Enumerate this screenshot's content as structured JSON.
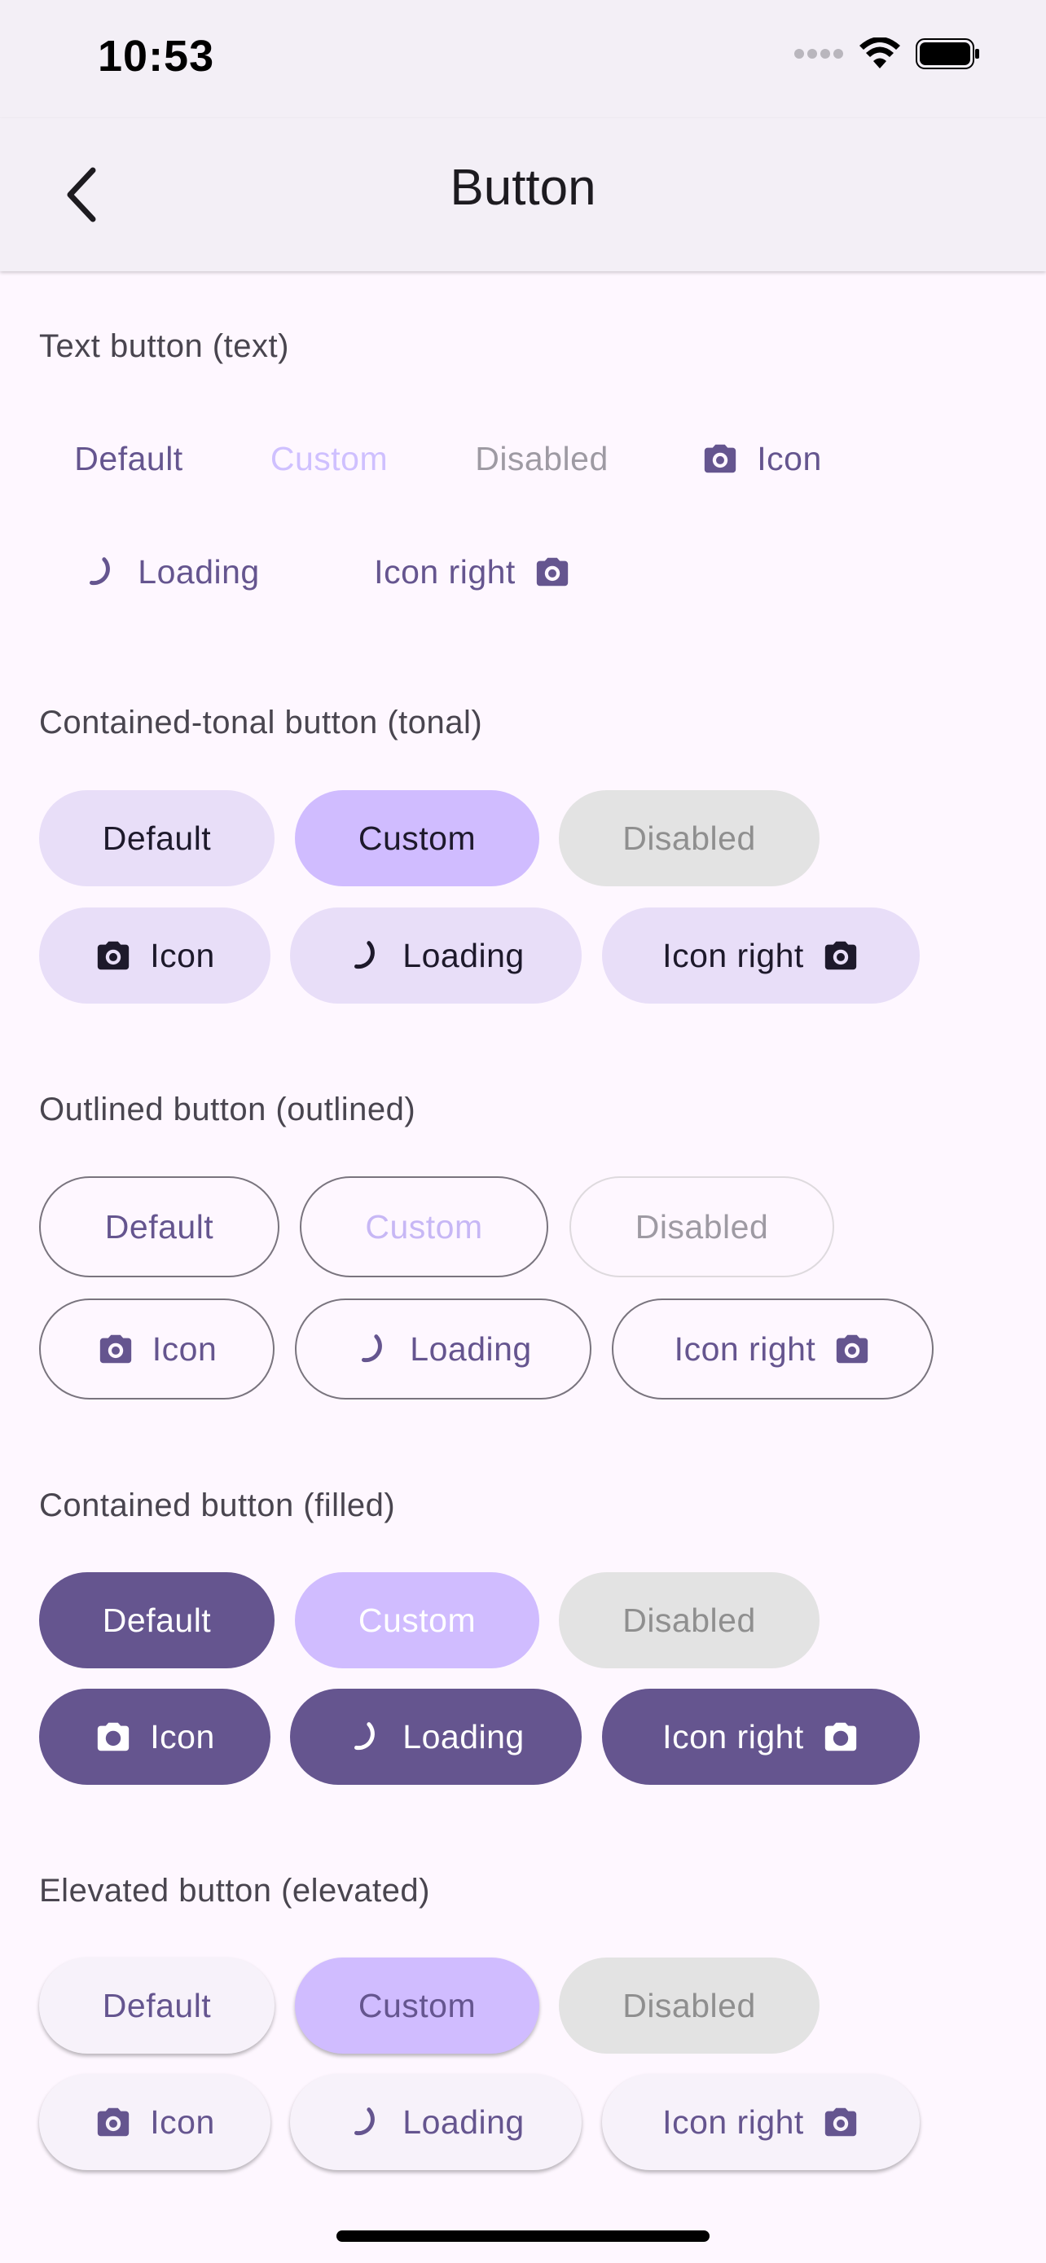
{
  "status_bar": {
    "time": "10:53"
  },
  "app_bar": {
    "title": "Button"
  },
  "colors": {
    "primary": "#65558f",
    "custom": "#d0bcff",
    "tonal": "#e8def8",
    "disabled_bg": "#e3e3e3",
    "background": "#fef7ff"
  },
  "sections": {
    "text": {
      "title": "Text button (text)",
      "buttons": {
        "default": "Default",
        "custom": "Custom",
        "disabled": "Disabled",
        "icon": "Icon",
        "loading": "Loading",
        "icon_right": "Icon right"
      }
    },
    "tonal": {
      "title": "Contained-tonal button (tonal)",
      "buttons": {
        "default": "Default",
        "custom": "Custom",
        "disabled": "Disabled",
        "icon": "Icon",
        "loading": "Loading",
        "icon_right": "Icon right"
      }
    },
    "outlined": {
      "title": "Outlined button (outlined)",
      "buttons": {
        "default": "Default",
        "custom": "Custom",
        "disabled": "Disabled",
        "icon": "Icon",
        "loading": "Loading",
        "icon_right": "Icon right"
      }
    },
    "filled": {
      "title": "Contained button (filled)",
      "buttons": {
        "default": "Default",
        "custom": "Custom",
        "disabled": "Disabled",
        "icon": "Icon",
        "loading": "Loading",
        "icon_right": "Icon right"
      }
    },
    "elevated": {
      "title": "Elevated button (elevated)",
      "buttons": {
        "default": "Default",
        "custom": "Custom",
        "disabled": "Disabled",
        "icon": "Icon",
        "loading": "Loading",
        "icon_right": "Icon right"
      }
    }
  },
  "icons": {
    "camera": "camera-icon",
    "loading": "loading-spinner-icon",
    "back": "chevron-left-icon"
  }
}
